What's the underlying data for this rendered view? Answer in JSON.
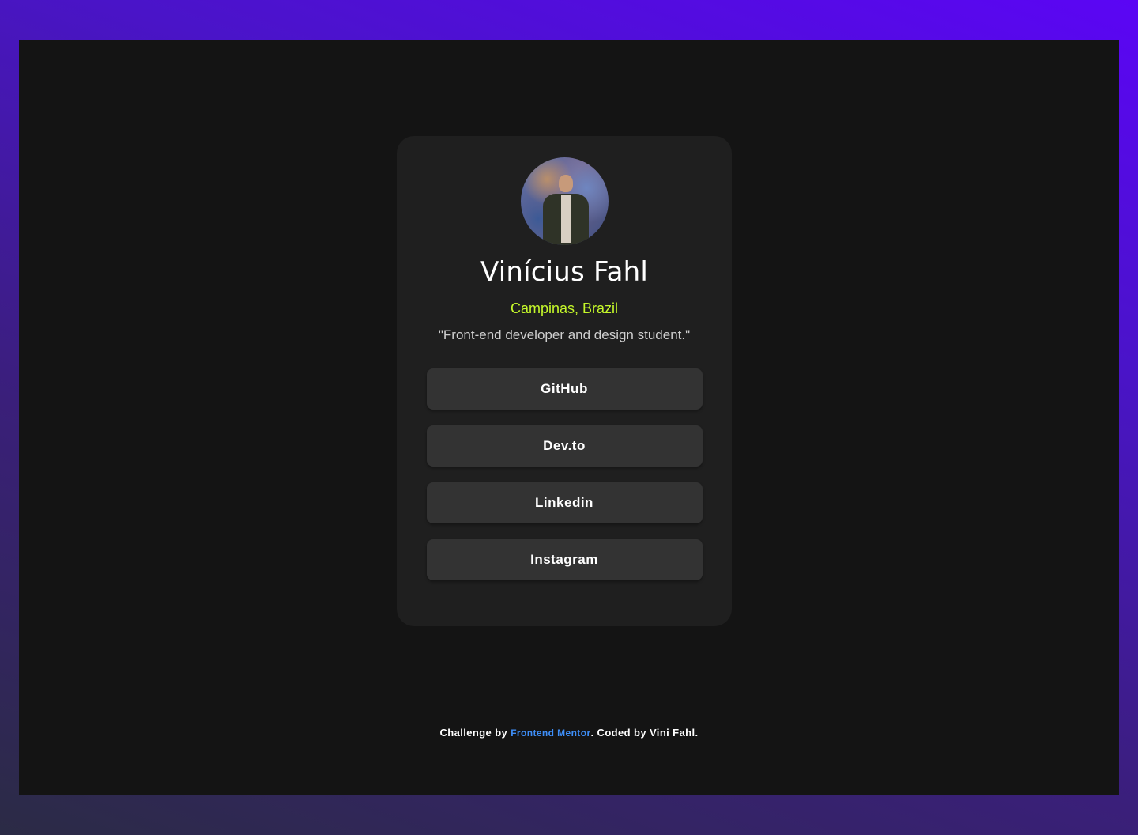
{
  "profile": {
    "name": "Vinícius Fahl",
    "location": "Campinas, Brazil",
    "bio": "\"Front-end developer and design student.\""
  },
  "links": [
    {
      "label": "GitHub"
    },
    {
      "label": "Dev.to"
    },
    {
      "label": "Linkedin"
    },
    {
      "label": "Instagram"
    }
  ],
  "footer": {
    "prefix": "Challenge by ",
    "link_text": "Frontend Mentor",
    "suffix": ". Coded by Vini Fahl."
  },
  "colors": {
    "accent_location": "#c5f82a",
    "footer_link": "#3e8ef7",
    "card_bg": "#1f1f1f",
    "button_bg": "#333333",
    "page_bg": "#141414"
  }
}
